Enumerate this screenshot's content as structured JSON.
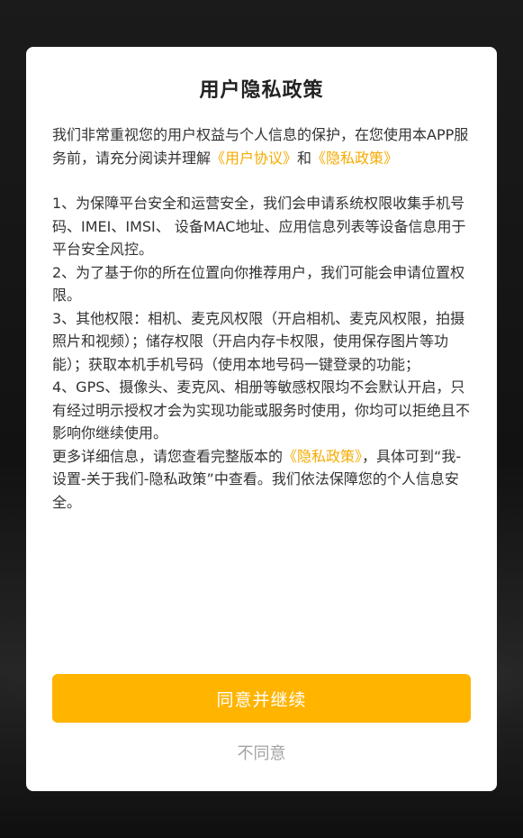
{
  "dialog": {
    "title": "用户隐私政策",
    "intro": {
      "before": "我们非常重视您的用户权益与个人信息的保护，在您使用本APP服务前，请充分阅读并理解",
      "link_user_agreement": "《用户协议》",
      "and": "和",
      "link_privacy_policy": "《隐私政策》"
    },
    "items": [
      "1、为保障平台安全和运营安全，我们会申请系统权限收集手机号码、IMEI、IMSI、 设备MAC地址、应用信息列表等设备信息用于平台安全风控。",
      "2、为了基于你的所在位置向你推荐用户，我们可能会申请位置权限。",
      "3、其他权限：相机、麦克风权限（开启相机、麦克风权限，拍摄照片和视频）；储存权限（开启内存卡权限，使用保存图片等功能）；获取本机手机号码（使用本地号码一键登录的功能；",
      "4、GPS、摄像头、麦克风、相册等敏感权限均不会默认开启，只有经过明示授权才会为实现功能或服务时使用，你均可以拒绝且不影响你继续使用。"
    ],
    "footer": {
      "before": "更多详细信息，请您查看完整版本的",
      "link_privacy_policy": "《隐私政策》",
      "after": "，具体可到“我-设置-关于我们-隐私政策”中查看。我们依法保障您的个人信息安全。"
    },
    "agree_label": "同意并继续",
    "disagree_label": "不同意"
  },
  "colors": {
    "accent": "#ffb400",
    "link": "#f5ab00",
    "text": "#333333",
    "muted": "#a3a3a3",
    "backdrop": "#141414"
  }
}
